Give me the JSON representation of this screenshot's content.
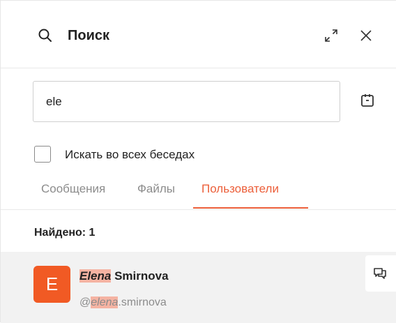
{
  "header": {
    "title": "Поиск",
    "icons": {
      "search": "search-icon",
      "expand": "expand-icon",
      "close": "close-icon"
    }
  },
  "search": {
    "value": "ele",
    "placeholder": "",
    "calendar_icon": "calendar-icon"
  },
  "options": {
    "search_all_label": "Искать во всех беседах",
    "search_all_checked": false
  },
  "tabs": [
    {
      "label": "Сообщения",
      "active": false
    },
    {
      "label": "Файлы",
      "active": false
    },
    {
      "label": "Пользователи",
      "active": true
    }
  ],
  "results": {
    "found_label": "Найдено: 1",
    "items": [
      {
        "avatar_letter": "E",
        "name_match": "Elena",
        "name_rest": " Smirnova",
        "handle_prefix": "@",
        "handle_match": "elena",
        "handle_rest": ".smirnova",
        "action_icon": "message-icon"
      }
    ]
  },
  "colors": {
    "accent": "#ec5f3a",
    "avatar_bg": "#f15a24",
    "highlight": "#f5b3a2",
    "row_bg": "#f2f2f2"
  }
}
